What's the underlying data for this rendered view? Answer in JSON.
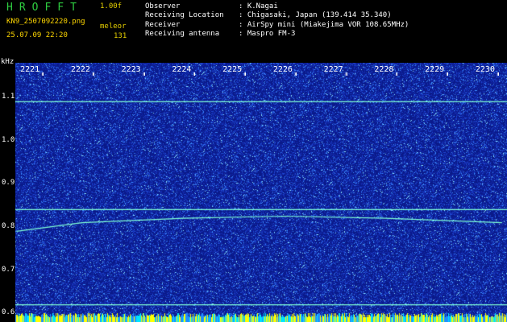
{
  "header": {
    "app_title": "HROFFT",
    "app_version": "1.00f",
    "file_name": "KN9_2507092220.png",
    "station_code": "meleor",
    "date_time": "25.07.09 22:20",
    "count": "131",
    "fields": [
      {
        "label": "Observer",
        "value": ": K.Nagai"
      },
      {
        "label": "Receiving Location",
        "value": ": Chigasaki, Japan (139.414 35.340)"
      },
      {
        "label": "Receiver",
        "value": ": AirSpy mini (Miakejima VOR 108.65MHz)"
      },
      {
        "label": "Receiving antenna",
        "value": ": Maspro FM-3"
      }
    ]
  },
  "chart_data": {
    "type": "heatmap",
    "ylabel": "kHz",
    "x_ticks": [
      "2221",
      "2222",
      "2223",
      "2224",
      "2225",
      "2226",
      "2227",
      "2228",
      "2229",
      "2230"
    ],
    "y_ticks": [
      "1.1",
      "1.0",
      "0.9",
      "0.8",
      "0.7",
      "0.6"
    ],
    "ylim": [
      0.58,
      1.18
    ],
    "colors": {
      "background": "#0a1a8a",
      "noise": "#3a7cff",
      "signal": "#7fffd4",
      "bottom_band": "#ffff00"
    },
    "traces": [
      {
        "kind": "horizontal",
        "y": 1.09
      },
      {
        "kind": "horizontal",
        "y": 0.84
      },
      {
        "kind": "curve",
        "points": [
          [
            2220.7,
            0.79
          ],
          [
            2222,
            0.81
          ],
          [
            2224,
            0.82
          ],
          [
            2226,
            0.825
          ],
          [
            2228,
            0.82
          ],
          [
            2230.3,
            0.81
          ]
        ]
      },
      {
        "kind": "horizontal",
        "y": 0.62
      }
    ]
  }
}
